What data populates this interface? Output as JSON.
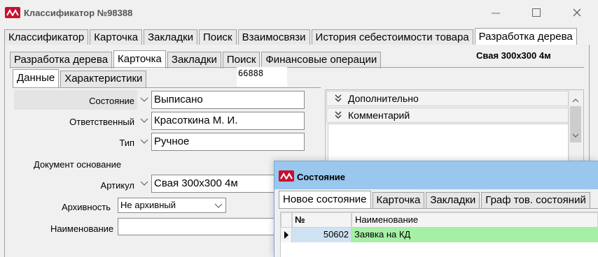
{
  "window": {
    "title": "Классификатор №98388",
    "controls": {
      "minimize": "minimize",
      "maximize": "maximize",
      "close": "close"
    }
  },
  "main_tabs": [
    {
      "label": "Классификатор"
    },
    {
      "label": "Карточка"
    },
    {
      "label": "Закладки"
    },
    {
      "label": "Поиск"
    },
    {
      "label": "Взаимосвязи"
    },
    {
      "label": "История себестоимости товара"
    },
    {
      "label": "Разработка дерева"
    }
  ],
  "sub_tabs": [
    {
      "label": "Разработка дерева"
    },
    {
      "label": "Карточка"
    },
    {
      "label": "Закладки"
    },
    {
      "label": "Поиск"
    },
    {
      "label": "Финансовые операции"
    }
  ],
  "item_caption": "Свая 300х300 4м",
  "inner_tabs": [
    {
      "label": "Данные"
    },
    {
      "label": "Характеристики"
    }
  ],
  "code_box": "66888",
  "form": {
    "state_label": "Состояние",
    "state_value": "Выписано",
    "responsible_label": "Ответственный",
    "responsible_value": "Красоткина М. И.",
    "type_label": "Тип",
    "type_value": "Ручное",
    "doc_basis_label": "Документ основание",
    "article_label": "Артикул",
    "article_value": "Свая 300х300 4м",
    "archive_label": "Архивность",
    "archive_value": "Не архивный",
    "name_label": "Наименование",
    "name_value": ""
  },
  "sections": {
    "additional": "Дополнительно",
    "comment": "Комментарий"
  },
  "dialog": {
    "title": "Состояние",
    "tabs": [
      {
        "label": "Новое состояние"
      },
      {
        "label": "Карточка"
      },
      {
        "label": "Закладки"
      },
      {
        "label": "Граф тов. состояний"
      }
    ],
    "grid": {
      "col_num": "№",
      "col_name": "Наименование",
      "rows": [
        {
          "num": "50602",
          "name": "Заявка на КД"
        }
      ]
    }
  },
  "colors": {
    "brand_red": "#c8102e",
    "dialog_title_bg": "#99c7ee",
    "selected_row_bg": "#a6f0a6",
    "selected_num_bg": "#cfe2f3"
  }
}
